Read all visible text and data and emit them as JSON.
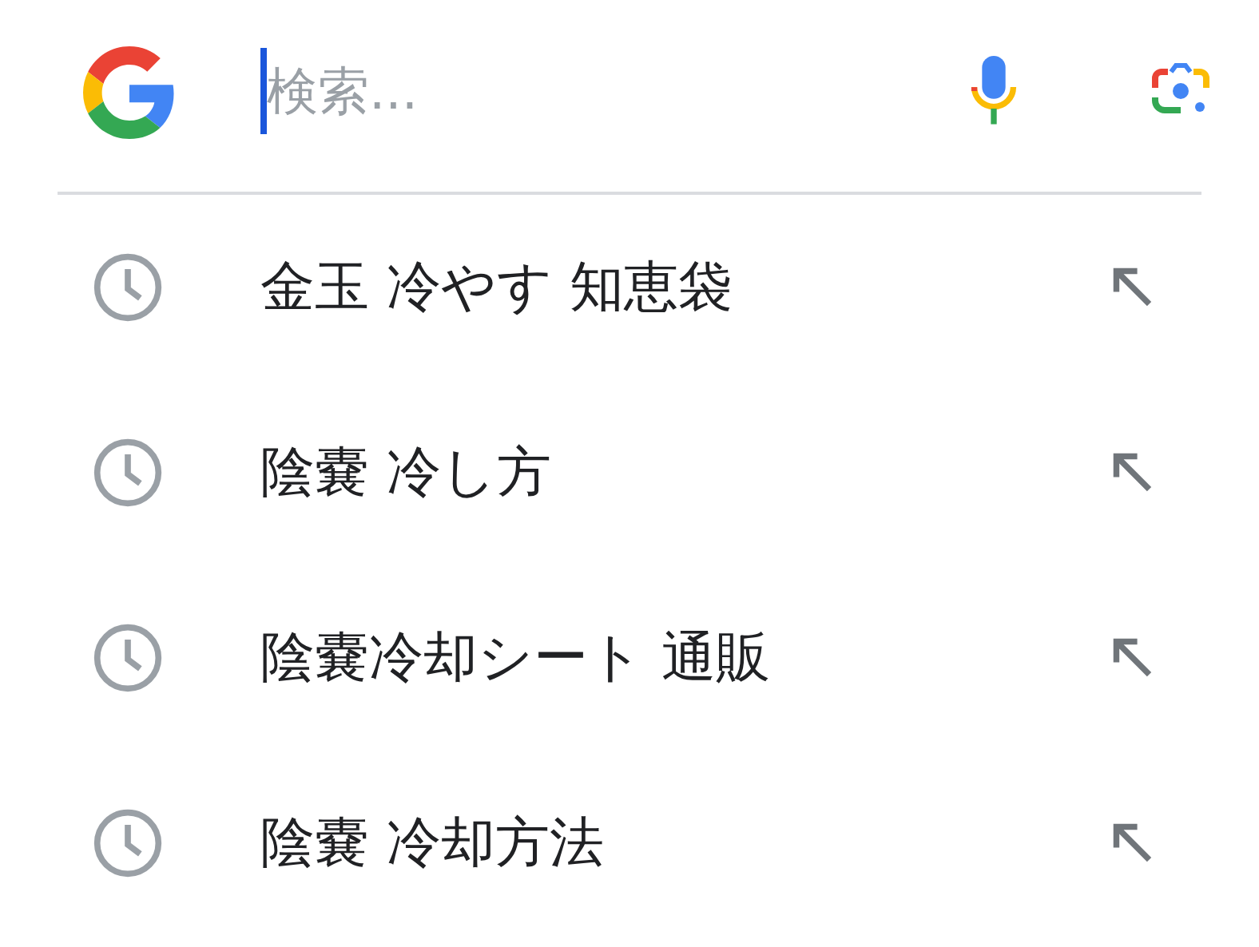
{
  "search": {
    "placeholder": "検索..."
  },
  "suggestions": [
    {
      "text": "金玉 冷やす 知恵袋"
    },
    {
      "text": "陰嚢 冷し方"
    },
    {
      "text": "陰嚢冷却シート 通販"
    },
    {
      "text": "陰嚢 冷却方法"
    }
  ]
}
